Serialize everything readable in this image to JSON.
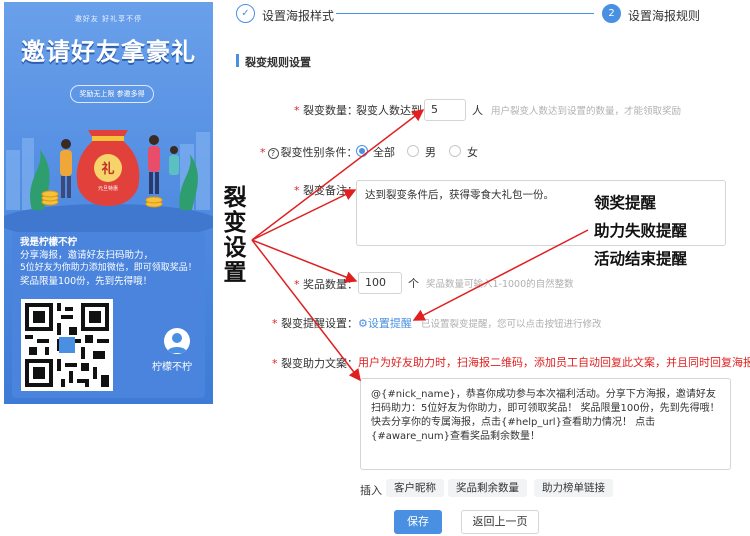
{
  "poster": {
    "tagline": "邀好友 好礼享不停",
    "headline": "邀请好友拿豪礼",
    "pill": "奖励无上限 参邀多得",
    "bag_char": "礼",
    "bag_sub": "元旦特惠",
    "desc_lines": [
      "我是柠檬不柠",
      "分享海报，邀请好友扫码助力，",
      "5位好友为你助力添加微信，即可领取奖品！",
      "奖品限量100份，先到先得哦！"
    ],
    "nickname": "柠檬不柠"
  },
  "steps": [
    {
      "number": "✓",
      "label": "设置海报样式",
      "status": "done"
    },
    {
      "number": "2",
      "label": "设置海报规则",
      "status": "active"
    }
  ],
  "section_title": "裂变规则设置",
  "form": {
    "fission_count": {
      "label": "裂变数量：",
      "prefix": "裂变人数达到",
      "value": "5",
      "unit": "人",
      "hint": "用户裂变人数达到设置的数量，才能领取奖励"
    },
    "gender": {
      "label": "裂变性别条件：",
      "options": [
        "全部",
        "男",
        "女"
      ],
      "selected": "全部"
    },
    "remark": {
      "label": "裂变备注：",
      "value": "达到裂变条件后，获得零食大礼包一份。"
    },
    "prize_count": {
      "label": "奖品数量：",
      "value": "100",
      "unit": "个",
      "hint": "奖品数量可输入1-1000的自然整数"
    },
    "reminder": {
      "label": "裂变提醒设置：",
      "link": "设置提醒",
      "hint": "已设置裂变提醒，您可以点击按钮进行修改"
    },
    "help_text": {
      "label": "裂变助力文案：",
      "note": "用户为好友助力时，扫海报二维码，添加员工自动回复此文案，并且同时回复海报",
      "value": "@{#nick_name}，恭喜你成功参与本次福利活动。分享下方海报，邀请好友扫码助力：5位好友为你助力，即可领取奖品！ 奖品限量100份，先到先得哦！\n快去分享你的专属海报，点击{#help_url}查看助力情况！ 点击{#aware_num}查看奖品剩余数量！"
    },
    "insert": {
      "label": "插入",
      "tags": [
        "客户昵称",
        "奖品剩余数量",
        "助力榜单链接"
      ]
    }
  },
  "buttons": {
    "save": "保存",
    "back": "返回上一页"
  },
  "annotations": {
    "big_label": "裂变设置",
    "callouts": [
      "领奖提醒",
      "助力失败提醒",
      "活动结束提醒"
    ]
  },
  "colors": {
    "accent": "#4a90e2",
    "required": "#e02020",
    "annotation_arrow": "#e02020"
  }
}
